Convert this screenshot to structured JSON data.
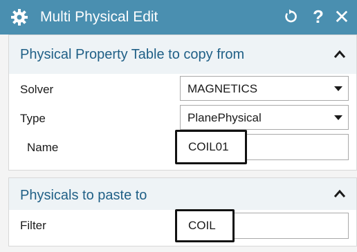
{
  "dialog": {
    "title": "Multi Physical Edit",
    "title_icon": "gear-icon",
    "controls": {
      "reset_icon": "reset-icon",
      "help_label": "?",
      "close_label": "✕"
    }
  },
  "copy_from": {
    "header": "Physical Property Table to copy from",
    "solver": {
      "label": "Solver",
      "value": "MAGNETICS"
    },
    "type": {
      "label": "Type",
      "value": "PlanePhysical"
    },
    "name": {
      "label": "Name",
      "value": "COIL01"
    }
  },
  "paste_to": {
    "header": "Physicals to paste to",
    "filter": {
      "label": "Filter",
      "value": "COIL"
    }
  },
  "colors": {
    "titlebar": "#4a8fb0",
    "section_header_text": "#1f5f86",
    "section_header_bg": "#eef3f6"
  }
}
